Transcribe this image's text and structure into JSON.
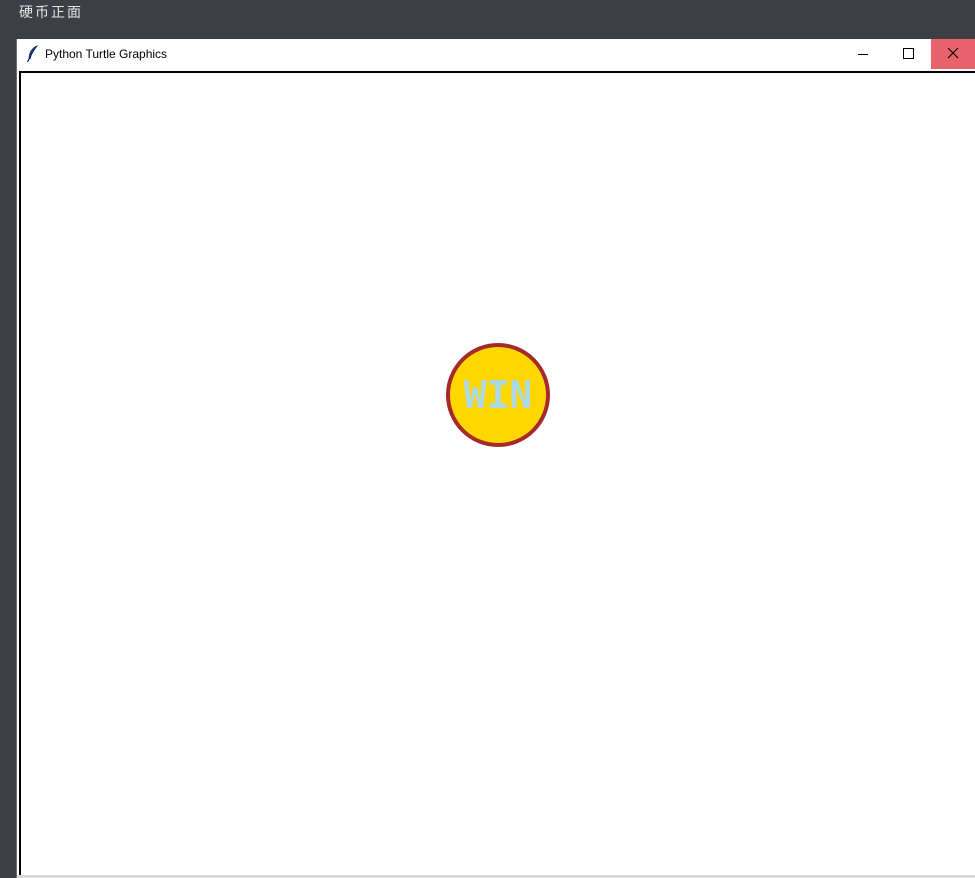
{
  "console": {
    "output_text": "硬币正面"
  },
  "window": {
    "title": "Python Turtle Graphics",
    "app_icon": "feather-icon",
    "controls": {
      "minimize_icon": "minimize-icon",
      "maximize_icon": "maximize-icon",
      "close_icon": "close-icon",
      "close_hover_color": "#e8636c"
    }
  },
  "canvas": {
    "background": "#ffffff",
    "coin": {
      "label": "WIN",
      "fill_color": "#ffd700",
      "outline_color": "#a52a2a",
      "label_color": "#add8e6"
    }
  }
}
